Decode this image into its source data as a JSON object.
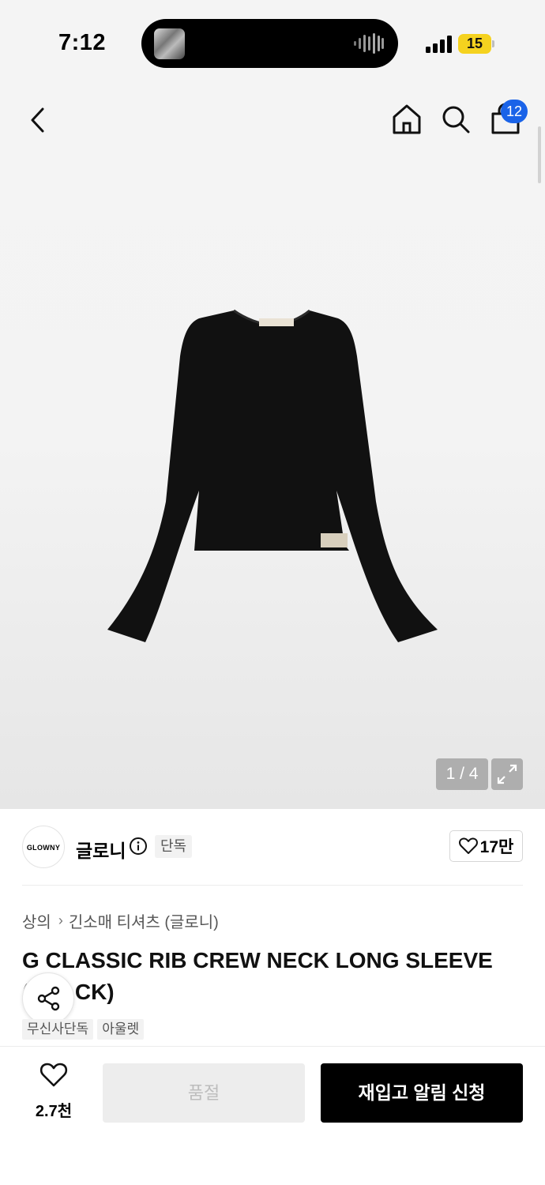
{
  "status_bar": {
    "time": "7:12",
    "battery": "15"
  },
  "header": {
    "cart_count": "12"
  },
  "gallery": {
    "counter": "1 / 4"
  },
  "brand": {
    "logo_text": "GLOWNY",
    "name": "글로니",
    "exclusive_label": "단독",
    "likes": "17만"
  },
  "breadcrumb": {
    "category": "상의",
    "subcategory": "긴소매 티셔츠 (글로니)"
  },
  "product": {
    "title": "G CLASSIC RIB CREW NECK LONG SLEEVE (BLACK)",
    "tags": [
      "무신사단독",
      "아울렛"
    ]
  },
  "bottom_bar": {
    "wish_count": "2.7천",
    "soldout_label": "품절",
    "restock_label": "재입고 알림 신청"
  },
  "colors": {
    "badge_blue": "#1a63e8",
    "battery_yellow": "#f5d21f",
    "primary_button": "#000000",
    "disabled_button": "#ededed"
  },
  "icons": [
    "back-icon",
    "home-icon",
    "search-icon",
    "cart-icon",
    "expand-icon",
    "info-icon",
    "heart-icon",
    "share-icon"
  ]
}
